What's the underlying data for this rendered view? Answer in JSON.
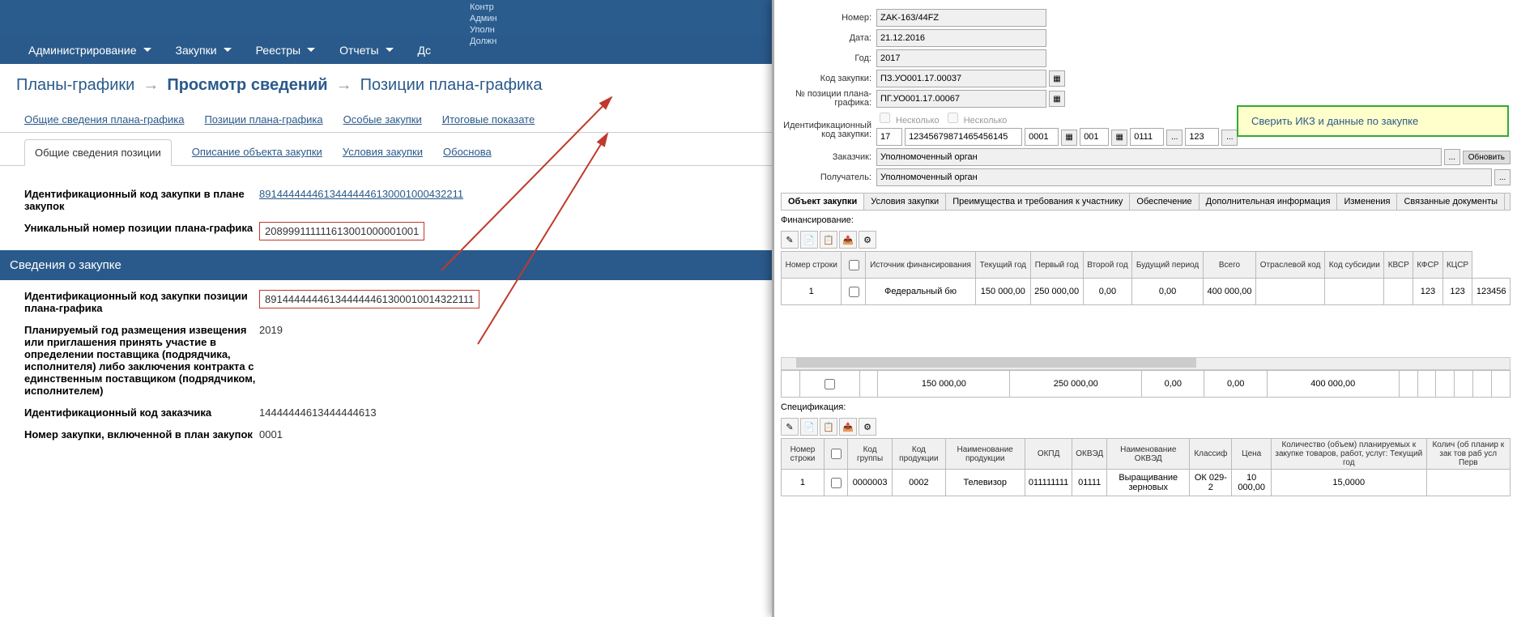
{
  "header_lines": [
    "Контр",
    "Админ",
    "Уполн",
    "Должн"
  ],
  "menu": [
    "Администрирование",
    "Закупки",
    "Реестры",
    "Отчеты",
    "Дс"
  ],
  "breadcrumb": {
    "a": "Планы-графики",
    "b": "Просмотр сведений",
    "c": "Позиции плана-графика"
  },
  "tabs_row1": [
    "Общие сведения плана-графика",
    "Позиции плана-графика",
    "Особые закупки",
    "Итоговые показате"
  ],
  "tabs_row2": [
    "Общие сведения позиции",
    "Описание объекта закупки",
    "Условия закупки",
    "Обоснова"
  ],
  "left": {
    "ikz_plan_label": "Идентификационный код закупки в плане закупок",
    "ikz_plan_val": "89144444446134444446130001000432211",
    "unique_label": "Уникальный номер позиции плана-графика",
    "unique_val": "208999111111613001000001001",
    "section": "Сведения о закупке",
    "ikz_pos_label": "Идентификационный код закупки позиции плана-графика",
    "ikz_pos_val": "891444444461344444461300010014322111",
    "year_label": "Планируемый год размещения извещения или приглашения принять участие в определении поставщика (подрядчика, исполнителя) либо заключения контракта с единственным поставщиком (подрядчиком, исполнителем)",
    "year_val": "2019",
    "cust_label": "Идентификационный код заказчика",
    "cust_val": "14444444613444444613",
    "num_label": "Номер закупки, включенной в план закупок",
    "num_val": "0001"
  },
  "right": {
    "number_label": "Номер:",
    "number_val": "ZAK-163/44FZ",
    "date_label": "Дата:",
    "date_val": "21.12.2016",
    "year_label": "Год:",
    "year_val": "2017",
    "code_label": "Код закупки:",
    "code_val": "ПЗ.УО001.17.00037",
    "pos_label": "№ позиции плана-графика:",
    "pos_val": "ПГ.УО001.17.00067",
    "ikz_label": "Идентификационный код закупки:",
    "ikz_parts": [
      "17",
      "12345679871465456145",
      "0001",
      "001",
      "0111",
      "123"
    ],
    "several": "Несколько",
    "customer_label": "Заказчик:",
    "customer_val": "Уполномоченный орган",
    "recipient_label": "Получатель:",
    "recipient_val": "Уполномоченный орган",
    "refresh": "Обновить",
    "sub_tabs": [
      "Объект закупки",
      "Условия закупки",
      "Преимущества и требования к участнику",
      "Обеспечение",
      "Дополнительная информация",
      "Изменения",
      "Связанные документы"
    ],
    "financing": "Финансирование:",
    "fin_headers": [
      "Номер строки",
      "",
      "Источник финансирования",
      "Текущий год",
      "Первый год",
      "Второй год",
      "Будущий период",
      "Всего",
      "Отраслевой код",
      "Код субсидии",
      "КВСР",
      "КФСР",
      "КЦСР"
    ],
    "fin_row": [
      "1",
      "",
      "Федеральный бю",
      "150 000,00",
      "250 000,00",
      "0,00",
      "0,00",
      "400 000,00",
      "",
      "",
      "",
      "123",
      "123",
      "123456"
    ],
    "fin_totals": [
      "",
      "",
      "",
      "150 000,00",
      "250 000,00",
      "0,00",
      "0,00",
      "400 000,00",
      "",
      "",
      "",
      "",
      "",
      ""
    ],
    "spec": "Спецификация:",
    "spec_headers": [
      "Номер строки",
      "",
      "Код группы",
      "Код продукции",
      "Наименование продукции",
      "ОКПД",
      "ОКВЭД",
      "Наименование ОКВЭД",
      "Классиф",
      "Цена",
      "Количество (объем) планируемых к закупке товаров, работ, услуг: Текущий год",
      "Колич (об планир к зак тов раб усл Перв"
    ],
    "spec_row": [
      "1",
      "",
      "0000003",
      "0002",
      "Телевизор",
      "011111111",
      "01111",
      "Выращивание зерновых",
      "ОК 029-2",
      "10 000,00",
      "15,0000",
      ""
    ],
    "callout": "Сверить ИКЗ и данные по закупке"
  }
}
